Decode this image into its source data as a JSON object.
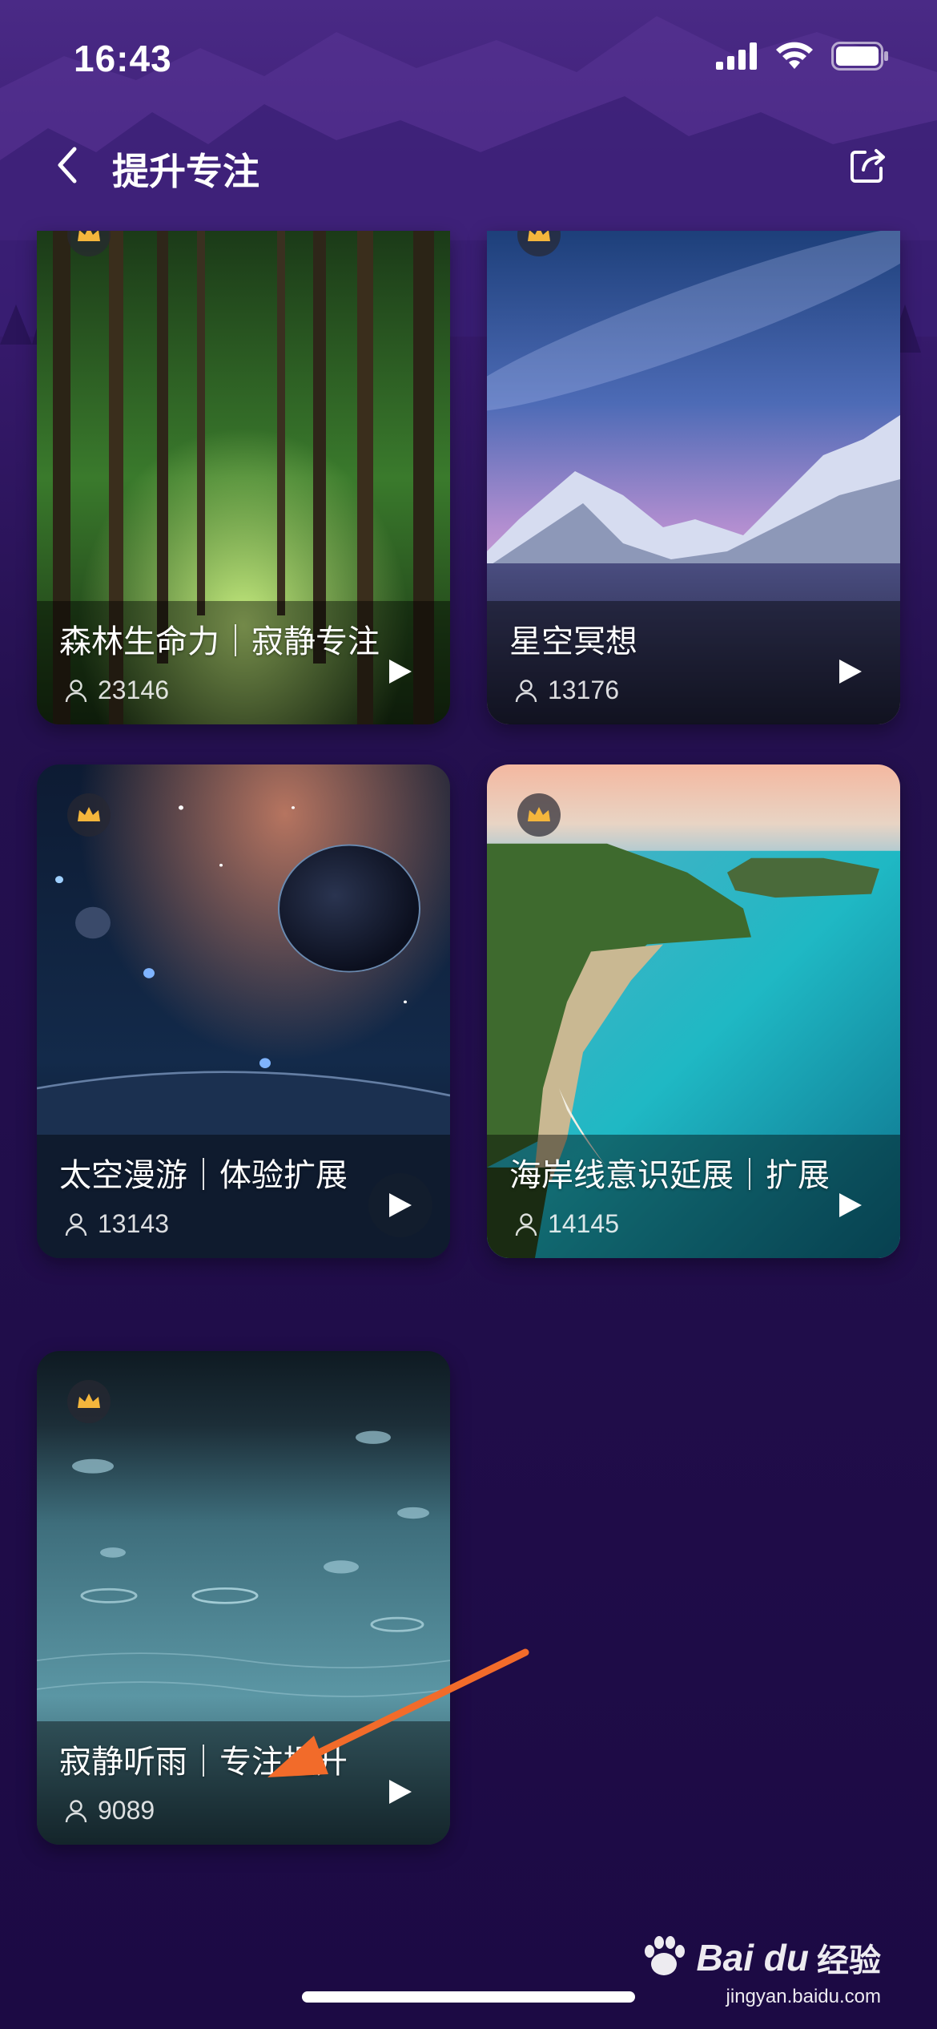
{
  "status_bar": {
    "time": "16:43",
    "icons": [
      "signal-icon",
      "wifi-icon",
      "battery-icon"
    ]
  },
  "nav": {
    "title": "提升专注",
    "back_icon": "chevron-left-icon",
    "share_icon": "share-icon"
  },
  "cards": [
    {
      "title": "森林生命力｜寂静专注",
      "plays": "23146",
      "premium": true,
      "theme": "forest"
    },
    {
      "title": "星空冥想",
      "plays": "13176",
      "premium": true,
      "theme": "starry-mountains"
    },
    {
      "title": "太空漫游｜体验扩展",
      "plays": "13143",
      "premium": true,
      "theme": "space"
    },
    {
      "title": "海岸线意识延展｜扩展",
      "plays": "14145",
      "premium": true,
      "theme": "coastline"
    },
    {
      "title": "寂静听雨｜专注提升",
      "plays": "9089",
      "premium": true,
      "theme": "rain"
    }
  ],
  "watermark": {
    "brand": "Bai du",
    "label": "经验",
    "url": "jingyan.baidu.com"
  },
  "colors": {
    "background": "#1e0c48",
    "header_purple": "#4b2a86",
    "crown_gold": "#f4b63c",
    "annotation_arrow": "#f26b2a"
  }
}
